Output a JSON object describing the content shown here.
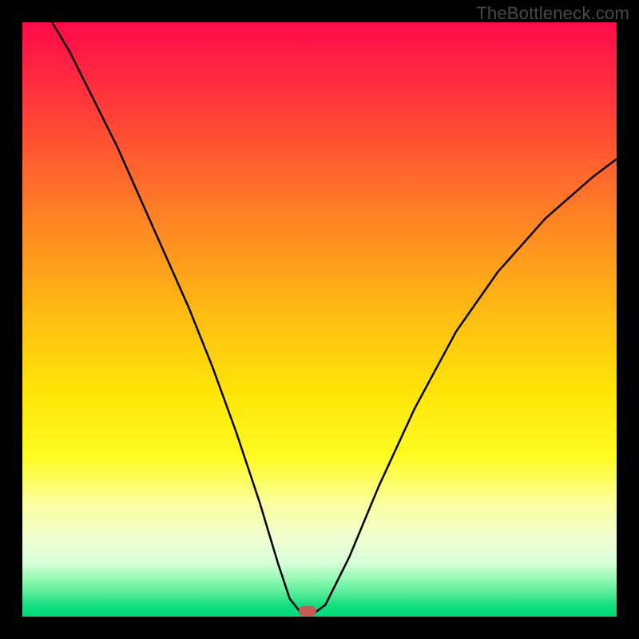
{
  "watermark": "TheBottleneck.com",
  "chart_data": {
    "type": "line",
    "title": "",
    "xlabel": "",
    "ylabel": "",
    "xlim": [
      0,
      100
    ],
    "ylim": [
      0,
      100
    ],
    "grid": false,
    "legend": false,
    "background": "rainbow-gradient (red top → green bottom)",
    "series": [
      {
        "name": "bottleneck-curve",
        "color": "#000000",
        "x": [
          5,
          8,
          12,
          16,
          20,
          24,
          28,
          32,
          36,
          40,
          43,
          45,
          47,
          49,
          51,
          55,
          60,
          66,
          73,
          80,
          88,
          96,
          100
        ],
        "y": [
          100,
          95,
          87,
          79,
          70,
          61,
          52,
          42,
          31,
          19,
          9,
          3,
          0.5,
          0.5,
          2,
          10,
          22,
          35,
          48,
          58,
          67,
          74,
          77
        ]
      }
    ],
    "minimum_marker": {
      "x": 48,
      "y": 0.5,
      "color": "#c75a55"
    }
  },
  "colors": {
    "frame": "#000000",
    "curve": "#000000",
    "marker": "#c75a55",
    "watermark": "#4a4a4a"
  }
}
